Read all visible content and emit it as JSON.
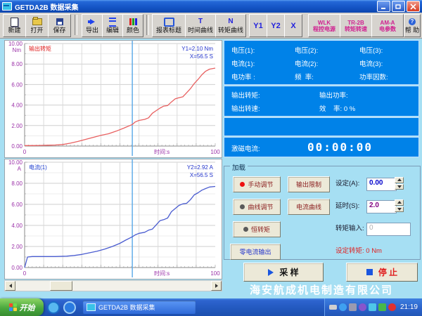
{
  "window": {
    "title": "GETDA2B 数据采集"
  },
  "toolbar": {
    "new": "新建",
    "open": "打开",
    "save": "保存",
    "export": "导出",
    "edit": "编辑",
    "color": "颜色",
    "report_title": "报表标题",
    "time_curve": "时间曲线",
    "time_curve_icon": "T",
    "torque_curve": "转矩曲线",
    "torque_curve_icon": "N",
    "y1": "Y1",
    "y2": "Y2",
    "x": "X",
    "wlk_line1": "WLK",
    "wlk_line2": "程控电源",
    "tr_line1": "TR-2B",
    "tr_line2": "转矩转速",
    "am_line1": "AM-A",
    "am_line2": "电参数",
    "help": "帮 助",
    "help_icon": "?"
  },
  "data_panel": {
    "row1": [
      "电压(1):",
      "电压(2):",
      "电压(3):"
    ],
    "row2": [
      "电流(1):",
      "电流(2):",
      "电流(3):"
    ],
    "row3": [
      "电功率 :",
      "频  率:",
      "功率因数:"
    ],
    "out1": [
      "输出转矩:",
      "输出功率:"
    ],
    "out2": [
      "输出转速:",
      "效    率: 0 %"
    ],
    "excitation": "激磁电流:",
    "timer": "00:00:00"
  },
  "load": {
    "title": "加载",
    "radios": [
      {
        "label": "手动调节",
        "selected": true
      },
      {
        "label": "曲线调节",
        "selected": false
      },
      {
        "label": "恒转矩",
        "selected": false
      }
    ],
    "zero_output": "零电流输出",
    "output_limit": "输出限制",
    "current_curve": "电流曲线",
    "set_label": "设定(A):",
    "set_value": "0.00",
    "delay_label": "延时(S):",
    "delay_value": "2.0",
    "torque_input_label": "转矩输入:",
    "torque_input_value": "0",
    "set_torque": "设定转矩: 0 Nm"
  },
  "actions": {
    "sample": "采  样",
    "stop": "停  止"
  },
  "company": "海安航成机电制造有限公司",
  "taskbar": {
    "start": "开始",
    "task": "GETDA2B 数据采集",
    "time": "21:19"
  },
  "chart_data": [
    {
      "type": "line",
      "title": "输出转矩",
      "title_color": "#e02020",
      "xlabel": "时间:s",
      "xlim": [
        0,
        100
      ],
      "ylim": [
        0,
        10
      ],
      "yticks": [
        0,
        2,
        4,
        6,
        8,
        10
      ],
      "ytick_labels": [
        "0.00",
        "2.00",
        "4.00",
        "6.00",
        "8.00",
        "10.00"
      ],
      "yunit": "Nm",
      "xtick_labels": [
        "0",
        "100"
      ],
      "grid": true,
      "cursor_x": 56.5,
      "annotations": [
        "Y1=2.10 Nm",
        "X=56.5 S"
      ],
      "series": [
        {
          "name": "输出转矩",
          "color": "#e86060",
          "x": [
            0,
            4,
            8,
            12,
            16,
            20,
            24,
            28,
            32,
            36,
            40,
            44,
            48,
            52,
            56.5,
            58,
            60,
            63,
            65,
            67,
            69,
            71,
            73,
            75,
            77,
            79,
            81,
            83,
            85,
            87,
            89,
            91,
            93,
            95,
            97,
            100
          ],
          "y": [
            0.05,
            0.05,
            0.06,
            0.08,
            0.1,
            0.15,
            0.28,
            0.45,
            0.65,
            0.85,
            1.05,
            1.2,
            1.45,
            1.75,
            2.1,
            2.35,
            2.5,
            2.6,
            2.75,
            3.2,
            3.45,
            3.7,
            3.9,
            3.95,
            4.3,
            4.6,
            4.72,
            4.8,
            5.2,
            5.6,
            6.1,
            6.5,
            6.95,
            7.3,
            7.5,
            7.6
          ]
        }
      ]
    },
    {
      "type": "line",
      "title": "电流(1)",
      "title_color": "#2040d0",
      "xlabel": "时间:s",
      "xlim": [
        0,
        100
      ],
      "ylim": [
        0,
        10
      ],
      "yticks": [
        0,
        2,
        4,
        6,
        8,
        10
      ],
      "ytick_labels": [
        "0.00",
        "2.00",
        "4.00",
        "6.00",
        "8.00",
        "10.00"
      ],
      "yunit": "A",
      "xtick_labels": [
        "0",
        "100"
      ],
      "grid": true,
      "cursor_x": 56.5,
      "annotations": [
        "Y2=2.92 A",
        "X=56.5 S"
      ],
      "series": [
        {
          "name": "电流(1)",
          "color": "#4a5cd0",
          "x": [
            0,
            1.5,
            4,
            10,
            16,
            22,
            26,
            30,
            34,
            38,
            42,
            46,
            50,
            53,
            56.5,
            58,
            60,
            63,
            65,
            67,
            69,
            71,
            73,
            75,
            77,
            79,
            81,
            83,
            85,
            87,
            89,
            91,
            93,
            95,
            97,
            100
          ],
          "y": [
            0,
            1.0,
            1.05,
            1.05,
            1.05,
            1.08,
            1.15,
            1.25,
            1.4,
            1.55,
            1.75,
            2.0,
            2.3,
            2.6,
            2.92,
            3.1,
            3.25,
            3.35,
            3.55,
            3.65,
            4.05,
            4.45,
            4.55,
            4.7,
            5.3,
            5.6,
            5.9,
            6.05,
            6.1,
            6.45,
            6.9,
            7.1,
            7.35,
            7.5,
            7.65,
            7.7
          ]
        }
      ]
    }
  ]
}
